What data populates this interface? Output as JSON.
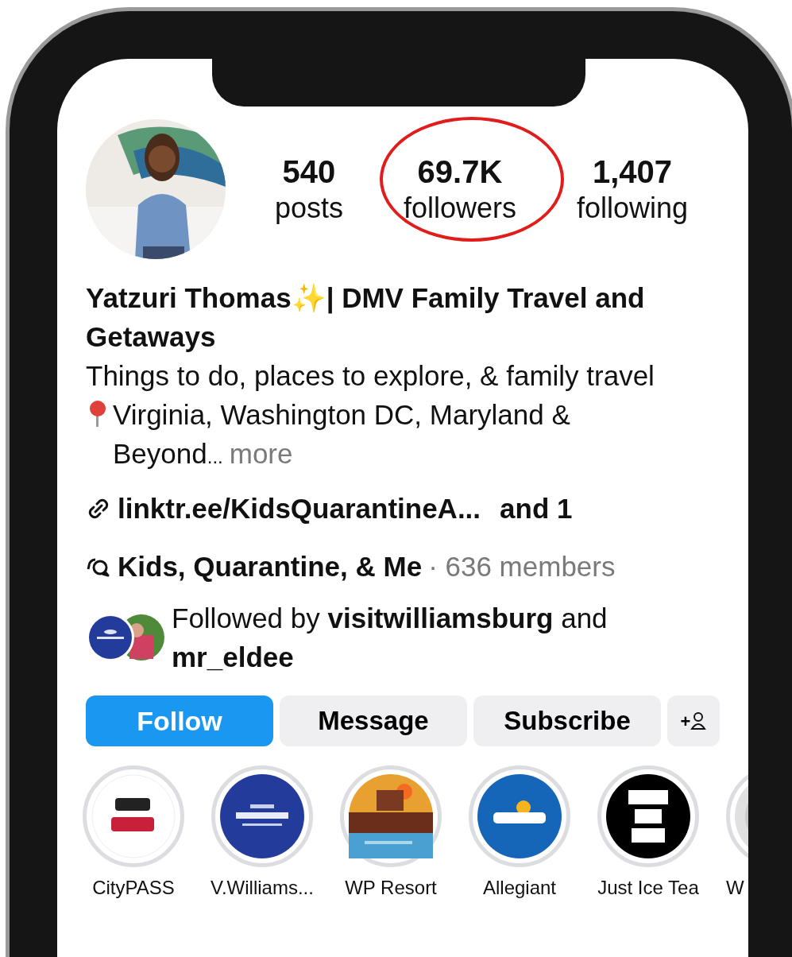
{
  "profile": {
    "stats": [
      {
        "value": "540",
        "label": "posts",
        "circled": false
      },
      {
        "value": "69.7K",
        "label": "followers",
        "circled": true
      },
      {
        "value": "1,407",
        "label": "following",
        "circled": false
      }
    ],
    "name": "Yatzuri Thomas✨| DMV Family Travel and Getaways",
    "bio": "Things to do, places to explore, & family travel",
    "location": "Virginia, Washington DC, Maryland & Beyond",
    "ellipsis": "...",
    "more": "more",
    "link": "linktr.ee/KidsQuarantineA...",
    "link_extra": "and 1",
    "community": "Kids, Quarantine, & Me",
    "community_members": "· 636 members",
    "followed_by": "Followed by **visitwilliamsburg** and **mr_eldee**"
  },
  "buttons": [
    {
      "kind": "primary",
      "label": "Follow"
    },
    {
      "kind": "secondary",
      "label": "Message"
    },
    {
      "kind": "secondary",
      "label": "Subscribe"
    },
    {
      "kind": "icon",
      "label": "+"
    }
  ],
  "highlights": [
    {
      "label": "CityPASS",
      "color": "#ffffff"
    },
    {
      "label": "V.Williams...",
      "color": "#233c9c"
    },
    {
      "label": "WP Resort",
      "color": "#e8a030"
    },
    {
      "label": "Allegiant",
      "color": "#1565b8"
    },
    {
      "label": "Just Ice Tea",
      "color": "#000000"
    },
    {
      "label": "W",
      "color": "#e0e0e0"
    }
  ]
}
